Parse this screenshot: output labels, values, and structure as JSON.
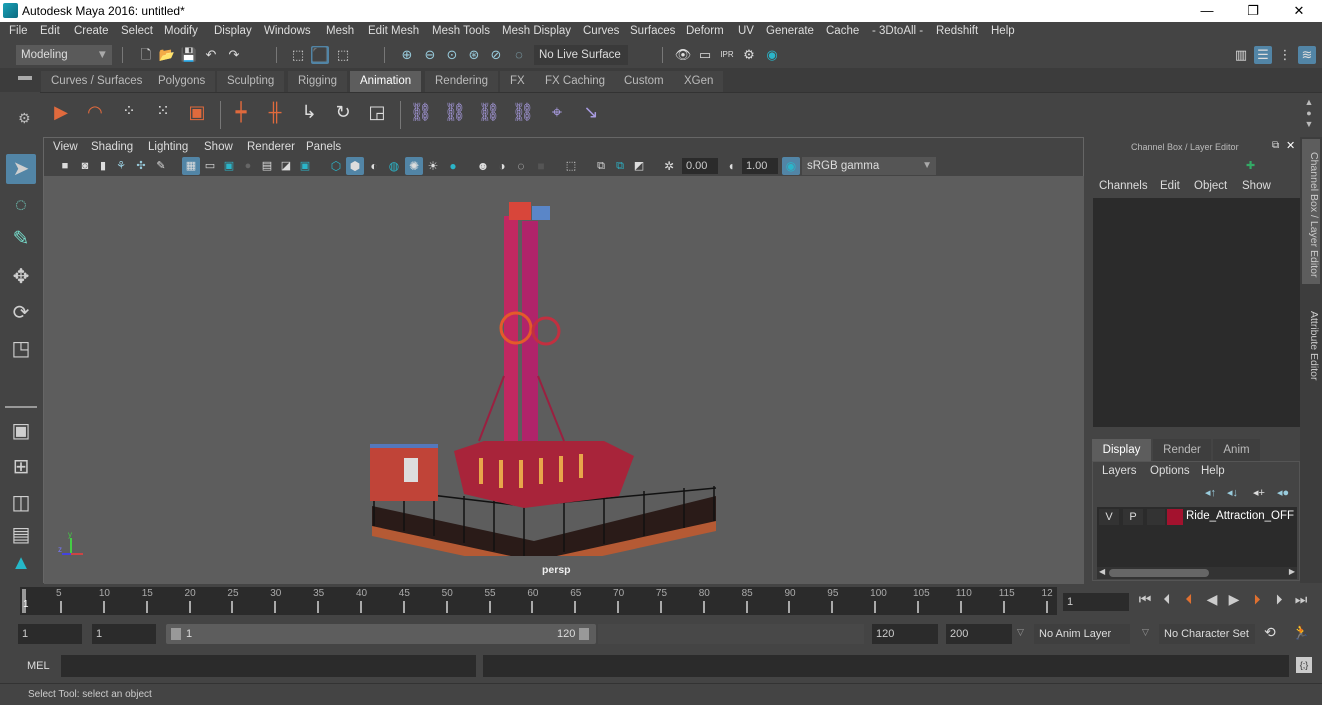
{
  "window": {
    "title": "Autodesk Maya 2016: untitled*",
    "controls": {
      "minimize": "—",
      "maximize": "❐",
      "close": "✕"
    }
  },
  "menubar": [
    "File",
    "Edit",
    "Create",
    "Select",
    "Modify",
    "Display",
    "Windows",
    "Mesh",
    "Edit Mesh",
    "Mesh Tools",
    "Mesh Display",
    "Curves",
    "Surfaces",
    "Deform",
    "UV",
    "Generate",
    "Cache",
    "- 3DtoAll -",
    "Redshift",
    "Help"
  ],
  "statusline": {
    "menu_set": "Modeling",
    "live_surface": "No Live Surface"
  },
  "shelf": {
    "tabs": [
      "Curves / Surfaces",
      "Polygons",
      "Sculpting",
      "Rigging",
      "Animation",
      "Rendering",
      "FX",
      "FX Caching",
      "Custom",
      "XGen"
    ],
    "active_tab": "Animation",
    "icons": [
      "playblast-icon",
      "set-driven-key-icon",
      "create-clip-icon",
      "ghost-icon",
      "motion-trail-icon",
      "set-key-icon",
      "set-breakdown-icon",
      "translate-key-icon",
      "rotate-key-icon",
      "scale-key-icon",
      "parent-constraint-icon",
      "point-constraint-icon",
      "orient-constraint-icon",
      "scale-constraint-icon",
      "aim-constraint-icon",
      "pole-vector-constraint-icon"
    ]
  },
  "viewport": {
    "menus": [
      "View",
      "Shading",
      "Lighting",
      "Show",
      "Renderer",
      "Panels"
    ],
    "exposure": "0.00",
    "gamma": "1.00",
    "color_space": "sRGB gamma",
    "camera_label": "persp",
    "axis": {
      "x": "x",
      "y": "y",
      "z": "z"
    }
  },
  "channel_box": {
    "title": "Channel Box / Layer Editor",
    "menus": [
      "Channels",
      "Edit",
      "Object",
      "Show"
    ]
  },
  "layer_editor": {
    "tabs": [
      "Display",
      "Render",
      "Anim"
    ],
    "active_tab": "Display",
    "menus": [
      "Layers",
      "Options",
      "Help"
    ],
    "layers": [
      {
        "visible": "V",
        "playback": "P",
        "color": "#a3122e",
        "name": "Ride_Attraction_OFF"
      }
    ]
  },
  "side_tabs": [
    "Channel Box / Layer Editor",
    "Attribute Editor"
  ],
  "timeline": {
    "ticks": [
      "5",
      "10",
      "15",
      "20",
      "25",
      "30",
      "35",
      "40",
      "45",
      "50",
      "55",
      "60",
      "65",
      "70",
      "75",
      "80",
      "85",
      "90",
      "95",
      "100",
      "105",
      "110",
      "115",
      "12"
    ],
    "current_frame_marker": "1",
    "current_frame": "1"
  },
  "range": {
    "start": "1",
    "playback_start": "1",
    "slider_start": "1",
    "slider_end": "120",
    "playback_end": "120",
    "end": "200",
    "anim_layer": "No Anim Layer",
    "character_set": "No Character Set"
  },
  "command_line": {
    "label": "MEL"
  },
  "help_line": "Select Tool: select an object"
}
